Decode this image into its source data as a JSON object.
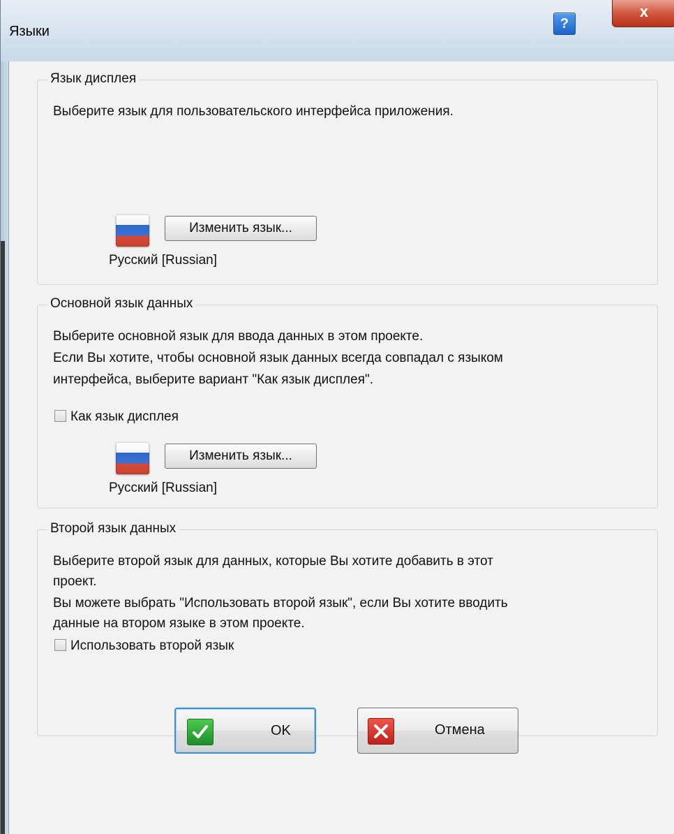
{
  "window": {
    "title": "Языки",
    "help_label": "?",
    "close_label": "x"
  },
  "display_language": {
    "legend": "Язык дисплея",
    "description": "Выберите язык для пользовательского интерфейса приложения.",
    "flag_icon": "russian-flag-icon",
    "change_button": "Изменить язык...",
    "current_language": "Русский [Russian]"
  },
  "primary_data_language": {
    "legend": "Основной язык данных",
    "description_line1": "Выберите основной язык для ввода данных в этом проекте.",
    "description_line2": "Если Вы хотите, чтобы основной язык данных всегда совпадал с языком",
    "description_line3": "интерфейса, выберите вариант \"Как язык дисплея\".",
    "same_as_display_label": "Как язык дисплея",
    "same_as_display_checked": false,
    "flag_icon": "russian-flag-icon",
    "change_button": "Изменить язык...",
    "current_language": "Русский [Russian]"
  },
  "second_data_language": {
    "legend": "Второй язык данных",
    "description_line1": "Выберите второй язык для данных, которые Вы хотите добавить в этот",
    "description_line2": "проект.",
    "description_line3": "Вы можете выбрать \"Использовать второй язык\", если Вы хотите вводить",
    "description_line4": "данные на втором языке в этом проекте.",
    "use_second_label": "Использовать второй язык",
    "use_second_checked": false
  },
  "footer": {
    "ok_label": "OK",
    "ok_icon": "green-check-icon",
    "cancel_label": "Отмена",
    "cancel_icon": "red-x-icon"
  },
  "colors": {
    "ok_accent": "#3c8fd8",
    "check_green": "#1b8f2b",
    "cancel_red": "#c0211a",
    "close_red": "#c8412a"
  }
}
